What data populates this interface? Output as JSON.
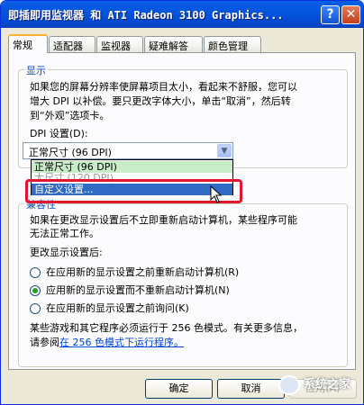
{
  "window": {
    "title": "即插即用监视器 和 ATI Radeon 3100 Graphics...",
    "help_label": "?",
    "close_label": "✕"
  },
  "tabs": [
    "常规",
    "适配器",
    "监视器",
    "疑难解答",
    "颜色管理"
  ],
  "display": {
    "group_title": "显示",
    "desc_lines": [
      "如果您的屏幕分辨率使屏幕项目太小，看起来不舒服，您可以",
      "增大 DPI 以补偿。要只更改字体大小，单击“取消”，然后转",
      "到“外观”选项卡。"
    ],
    "dpi_label": "DPI 设置(D):",
    "dpi_value": "正常尺寸 (96 DPI)",
    "options": [
      "正常尺寸 (96 DPI)",
      "大尺寸 (120 DPI)",
      "自定义设置..."
    ]
  },
  "compat": {
    "group_title": "兼容性",
    "desc_lines": [
      "如果在更改显示设置后不立即重新启动计算机，某些程序可能",
      "无法正常工作。"
    ],
    "after_label": "更改显示设置后:",
    "radios": [
      "在应用新的显示设置之前重新启动计算机(R)",
      "应用新的显示设置而不重新启动计算机(N)",
      "在应用新的显示设置之前询问(K)"
    ],
    "selected_index": 1
  },
  "note": {
    "line1": "某些游戏和其它程序必须运行于 256 色模式。有关更多信息，",
    "line2_prefix": "请参阅",
    "link": "在 256 色模式下运行程序。"
  },
  "buttons": {
    "ok": "确定",
    "cancel": "取消",
    "apply": "应用(A)"
  },
  "watermark": "系统之家",
  "icons": {
    "help": "help-icon",
    "close": "close-icon",
    "dropdown": "chevron-down-icon",
    "cursor": "mouse-pointer-icon"
  },
  "colors": {
    "titlebar": "#0355dc",
    "selection": "#316ac5",
    "highlight_box": "#e1172f",
    "link": "#0046d5"
  }
}
